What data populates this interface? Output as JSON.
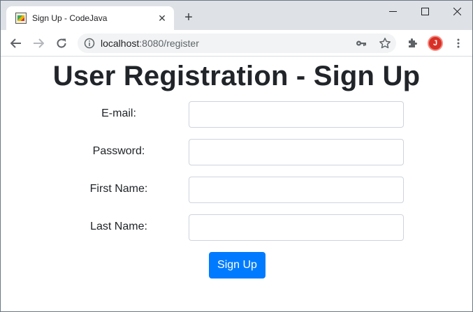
{
  "browser": {
    "tab_title": "Sign Up - CodeJava",
    "close_glyph": "✕",
    "newtab_glyph": "+",
    "url_host": "localhost",
    "url_path": ":8080/register",
    "avatar_initial": "J",
    "accent_color": "#007bff"
  },
  "page": {
    "title": "User Registration - Sign Up",
    "fields": [
      {
        "label": "E-mail:",
        "value": "",
        "placeholder": ""
      },
      {
        "label": "Password:",
        "value": "",
        "placeholder": ""
      },
      {
        "label": "First Name:",
        "value": "",
        "placeholder": ""
      },
      {
        "label": "Last Name:",
        "value": "",
        "placeholder": ""
      }
    ],
    "submit_label": "Sign Up"
  }
}
